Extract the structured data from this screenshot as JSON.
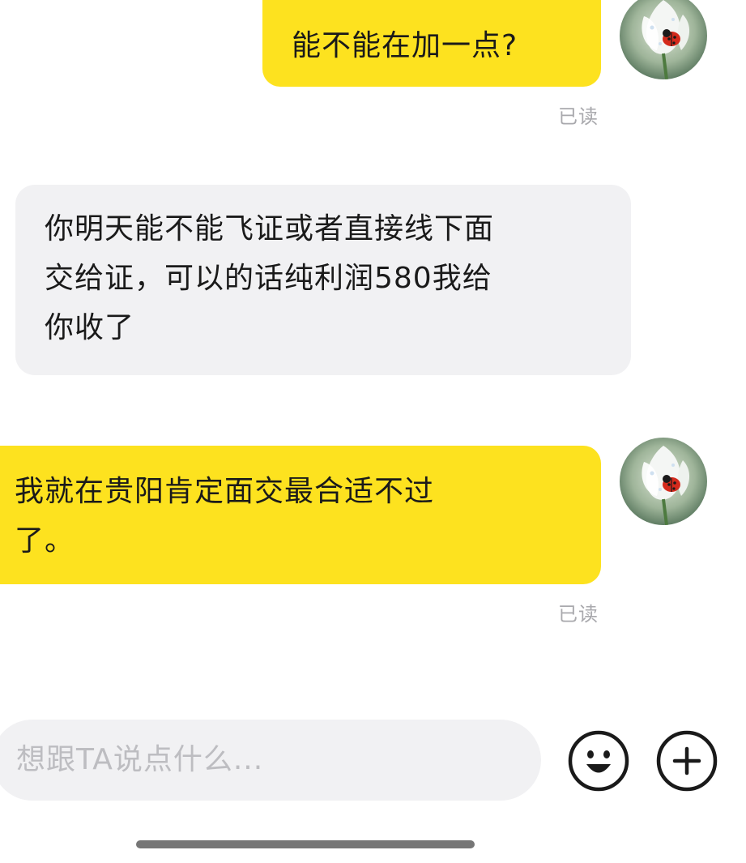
{
  "messages": [
    {
      "direction": "outgoing",
      "text": "能不能在加一点?",
      "status": "已读"
    },
    {
      "direction": "incoming",
      "lines": [
        "你明天能不能飞证或者直接线下面",
        "交给证，可以的话纯利润580我给",
        "你收了"
      ]
    },
    {
      "direction": "outgoing",
      "lines": [
        "我就在贵阳肯定面交最合适不过",
        "了。"
      ],
      "status": "已读"
    }
  ],
  "composer": {
    "placeholder": "想跟TA说点什么...",
    "emoji_icon": "emoji-smile-icon",
    "plus_icon": "plus-icon"
  },
  "avatar": {
    "icon": "ladybug-flower-avatar"
  },
  "colors": {
    "outgoing_bubble": "#fde21f",
    "incoming_bubble": "#f1f1f3",
    "read_receipt": "#a9a9ad",
    "placeholder": "#bdbdc1"
  }
}
